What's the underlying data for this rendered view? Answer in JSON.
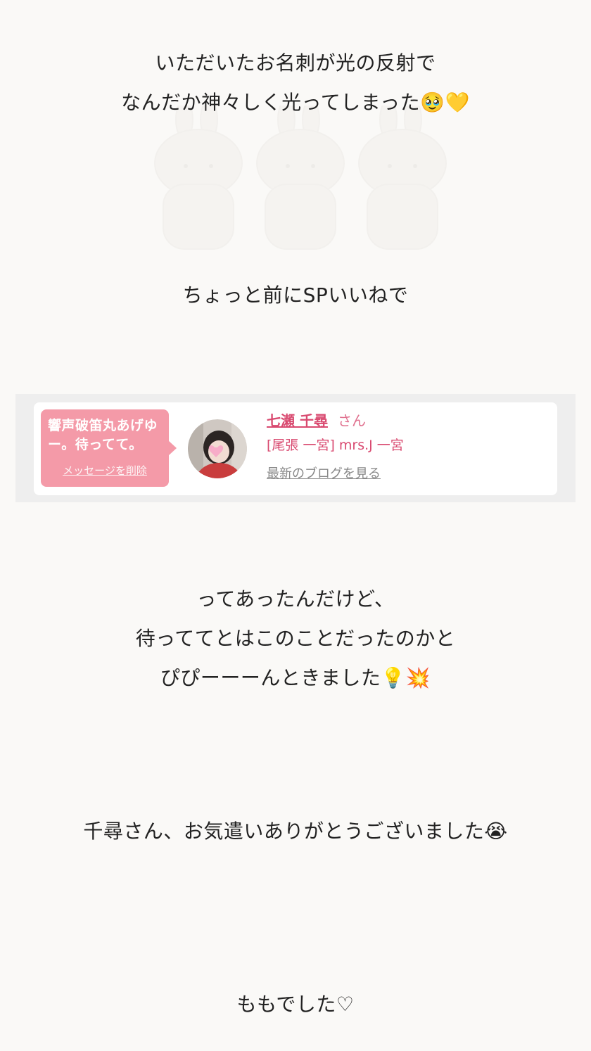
{
  "post": {
    "para1": {
      "line1": "いただいたお名刺が光の反射で",
      "line2": "なんだか神々しく光ってしまった🥹💛"
    },
    "para2": {
      "line1": "ちょっと前にSPいいねで"
    },
    "sp_card": {
      "message": "響声破笛丸あげゆー。待ってて。",
      "delete_link": "メッセージを削除",
      "name": "七瀬 千尋",
      "honorific": "さん",
      "shop": "[尾張 一宮] mrs.J 一宮",
      "blog_link": "最新のブログを見る"
    },
    "para3": {
      "line1": "ってあったんだけど、",
      "line2": "待っててとはこのことだったのかと",
      "line3": "ぴぴーーーんときました💡💥"
    },
    "para4": {
      "line1": "千尋さん、お気遣いありがとうございました😭"
    },
    "signoff": {
      "line1": "ももでした♡"
    }
  },
  "colors": {
    "background": "#faf9f7",
    "bubble": "#f49aa8",
    "accent_pink": "#d94a70"
  }
}
